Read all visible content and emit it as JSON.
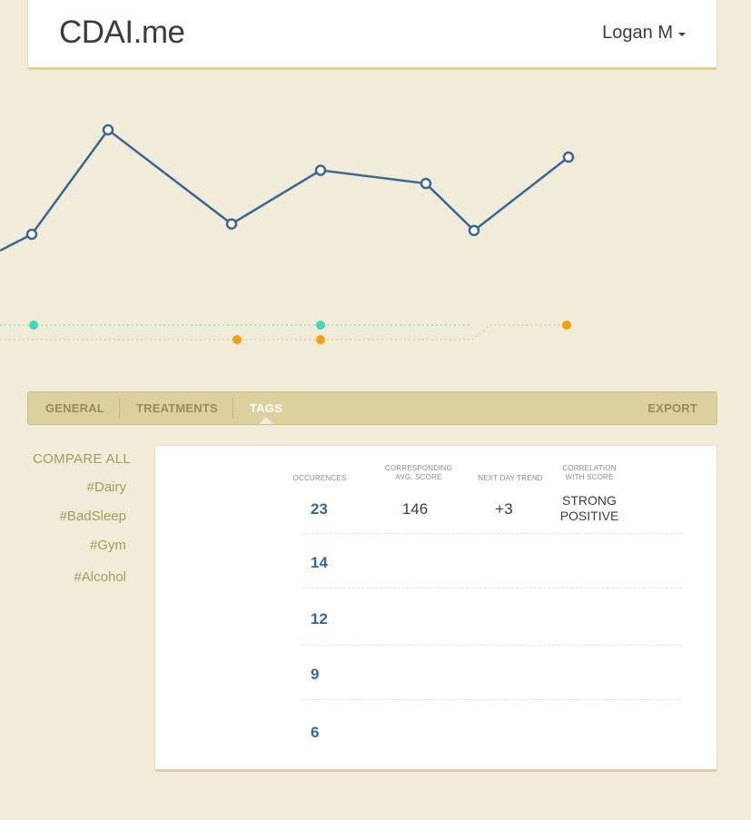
{
  "header": {
    "logo": "CDAI.me",
    "user_name": "Logan M"
  },
  "chart_data": {
    "type": "line",
    "series": [
      {
        "values": [
          null,
          220,
          331,
          231,
          288,
          274,
          224,
          302
        ]
      }
    ],
    "markers": {
      "tag_row_1_color": "#3ddbb9",
      "tag_row_2_color": "#f5a100"
    },
    "line_color": "#3b6793",
    "grid": false
  },
  "tabs": {
    "general": "GENERAL",
    "treatments": "TREATMENTS",
    "tags": "TAGS",
    "export": "EXPORT",
    "active": "tags"
  },
  "sidebar": {
    "compare_all": "COMPARE ALL",
    "tags": [
      "#Dairy",
      "#BadSleep",
      "#Gym",
      "#Alcohol"
    ]
  },
  "table": {
    "columns": {
      "occurences": "OCCURENCES",
      "avg_score_1": "CORRESPONDING",
      "avg_score_2": "AVG. SCORE",
      "next_day_trend": "NEXT DAY TREND",
      "correlation_1": "CORRELATION",
      "correlation_2": "WITH SCORE"
    },
    "first_row": {
      "occurences": "23",
      "avg_score": "146",
      "next_day_trend": "+3",
      "correlation_1": "STRONG",
      "correlation_2": "POSITIVE"
    },
    "occurences": [
      "14",
      "12",
      "9",
      "6"
    ]
  },
  "colors": {
    "accent": "#3b6793",
    "background": "#f1ecda",
    "tab_bar": "#dcd09f"
  }
}
